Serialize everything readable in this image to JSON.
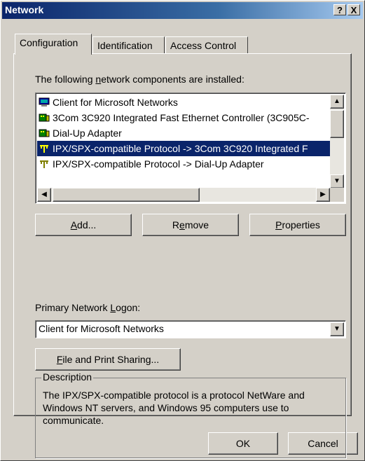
{
  "window": {
    "title": "Network",
    "help_button": "?",
    "close_button": "X"
  },
  "tabs": [
    {
      "label": "Configuration",
      "active": true
    },
    {
      "label": "Identification",
      "active": false
    },
    {
      "label": "Access Control",
      "active": false
    }
  ],
  "components": {
    "label_pre": "The following ",
    "label_underline": "n",
    "label_post": "etwork components are installed:",
    "items": [
      {
        "icon": "client-icon",
        "text": "Client for Microsoft Networks",
        "selected": false
      },
      {
        "icon": "network-adapter-icon",
        "text": "3Com 3C920 Integrated Fast Ethernet Controller (3C905C-",
        "selected": false
      },
      {
        "icon": "network-adapter-icon",
        "text": "Dial-Up Adapter",
        "selected": false
      },
      {
        "icon": "protocol-icon",
        "text": "IPX/SPX-compatible Protocol -> 3Com 3C920 Integrated F",
        "selected": true
      },
      {
        "icon": "protocol-icon",
        "text": "IPX/SPX-compatible Protocol -> Dial-Up Adapter",
        "selected": false
      }
    ]
  },
  "buttons": {
    "add_u": "A",
    "add_rest": "dd...",
    "remove_pre": "R",
    "remove_u": "e",
    "remove_post": "move",
    "properties_u": "P",
    "properties_rest": "roperties",
    "file_print_u": "F",
    "file_print_rest": "ile and Print Sharing...",
    "ok": "OK",
    "cancel": "Cancel"
  },
  "logon": {
    "label_pre": "Primary Network ",
    "label_u": "L",
    "label_post": "ogon:",
    "value": "Client for Microsoft Networks"
  },
  "description": {
    "title": "Description",
    "text": "The IPX/SPX-compatible protocol is a protocol NetWare and Windows NT servers, and Windows 95 computers use to communicate."
  },
  "colors": {
    "titlebar_start": "#0a246a",
    "titlebar_end": "#a6caf0",
    "selection": "#0a246a",
    "face": "#d4d0c8"
  }
}
